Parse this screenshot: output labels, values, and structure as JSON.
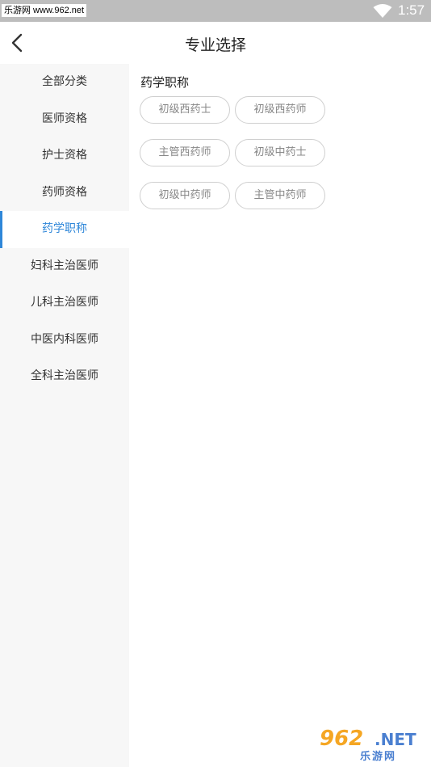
{
  "status_bar": {
    "watermark": "乐游网 www.962.net",
    "time": "1:57",
    "wifi_icon": "wifi-icon",
    "battery_icon": "battery-icon"
  },
  "header": {
    "title": "专业选择",
    "back_icon": "back-chevron-icon"
  },
  "sidebar": {
    "active_index": 4,
    "accent_color": "#2f87d9",
    "items": [
      {
        "label": "全部分类"
      },
      {
        "label": "医师资格"
      },
      {
        "label": "护士资格"
      },
      {
        "label": "药师资格"
      },
      {
        "label": "药学职称"
      },
      {
        "label": "妇科主治医师"
      },
      {
        "label": "儿科主治医师"
      },
      {
        "label": "中医内科医师"
      },
      {
        "label": "全科主治医师"
      }
    ]
  },
  "main": {
    "section_title": "药学职称",
    "tags": [
      {
        "label": "初级西药士"
      },
      {
        "label": "初级西药师"
      },
      {
        "label": "主管西药师"
      },
      {
        "label": "初级中药士"
      },
      {
        "label": "初级中药师"
      },
      {
        "label": "主管中药师"
      }
    ]
  },
  "watermark_bottom": {
    "brand_number": "962",
    "brand_domain": ".NET",
    "brand_name": "乐游网"
  }
}
